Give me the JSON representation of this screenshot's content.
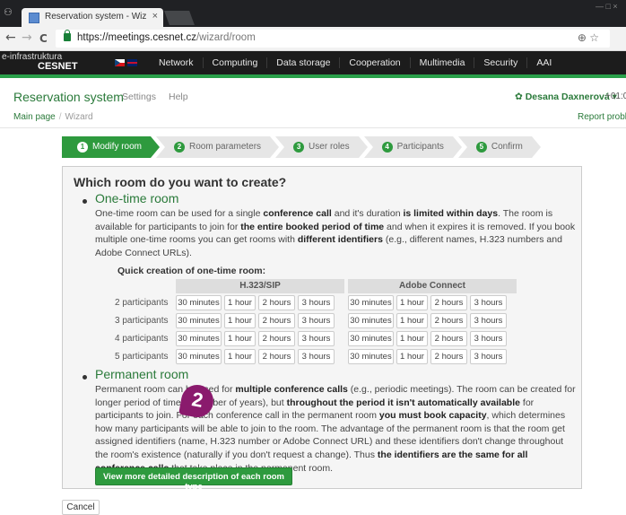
{
  "browser": {
    "app_icon": "⚇",
    "tab_title": "Reservation system - Wiz",
    "tab_close": "×",
    "url_host": "https://meetings.cesnet.cz",
    "url_path": "/wizard/room",
    "nav_back": "←",
    "nav_forward": "→",
    "nav_reload": "C",
    "omni_icons": "⊕ ☆",
    "window_controls": "— □ ×"
  },
  "site": {
    "logo_line1": "e-infrastruktura",
    "logo_line2": "CESNET",
    "nav": [
      "Network",
      "Computing",
      "Data storage",
      "Cooperation",
      "Multimedia",
      "Security",
      "AAI"
    ]
  },
  "app": {
    "brand": "Reservation system",
    "settings": "Settings",
    "help": "Help",
    "user": "✿ Desana Daxnerová ▾",
    "timezone": "+01:0",
    "breadcrumb": [
      "Main page",
      "Wizard"
    ],
    "report": "Report problem"
  },
  "wizard": {
    "steps": [
      {
        "num": "1",
        "label": "Modify room"
      },
      {
        "num": "2",
        "label": "Room parameters"
      },
      {
        "num": "3",
        "label": "User roles"
      },
      {
        "num": "4",
        "label": "Participants"
      },
      {
        "num": "5",
        "label": "Confirm"
      }
    ],
    "active_step": 1
  },
  "main": {
    "question": "Which room do you want to create?",
    "one_time": {
      "title": "One-time room",
      "p1": "One-time room can be used for a single ",
      "b1": "conference call",
      "p2": " and it's duration ",
      "b2": "is limited within days",
      "p3": ". The room is available for participants to join for ",
      "b3": "the entire booked period of time",
      "p4": " and when it expires it is removed. If you book multiple one-time rooms you can get rooms with ",
      "b4": "different identifiers",
      "p5": " (e.g., different names, H.323 numbers and Adobe Connect URLs)."
    },
    "quick": {
      "title": "Quick creation of one-time room:",
      "groups": [
        "H.323/SIP",
        "Adobe Connect"
      ],
      "durations": [
        "30 minutes",
        "1 hour",
        "2 hours",
        "3 hours"
      ],
      "rows": [
        "2 participants",
        "3 participants",
        "4 participants",
        "5 participants"
      ]
    },
    "permanent": {
      "title": "Permanent room",
      "p1": "Permanent room can be used for ",
      "b1": "multiple conference calls",
      "p2": " (e.g., periodic meetings). The room can be created for longer period of time (a number of years), but ",
      "b2": "throughout the period it isn't automatically available",
      "p3": " for participants to join. For each conference call in the permanent room ",
      "b3": "you must book capacity",
      "p4": ", which determines how many participants will be able to join to the room. The advantage of the permanent room is that the room get assigned identifiers (name, H.323 number or Adobe Connect URL) and these identifiers don't change throughout the room's existence (naturally if you don't request a change). Thus ",
      "b4": "the identifiers are the same for all conference calls",
      "p5": " that take place in the permanent room."
    },
    "more_button": "View more detailed description of each room type",
    "cancel": "Cancel"
  },
  "annotation": {
    "marker": "2"
  },
  "colors": {
    "brand_green": "#2e9a3e",
    "marker": "#8a1a6d"
  }
}
